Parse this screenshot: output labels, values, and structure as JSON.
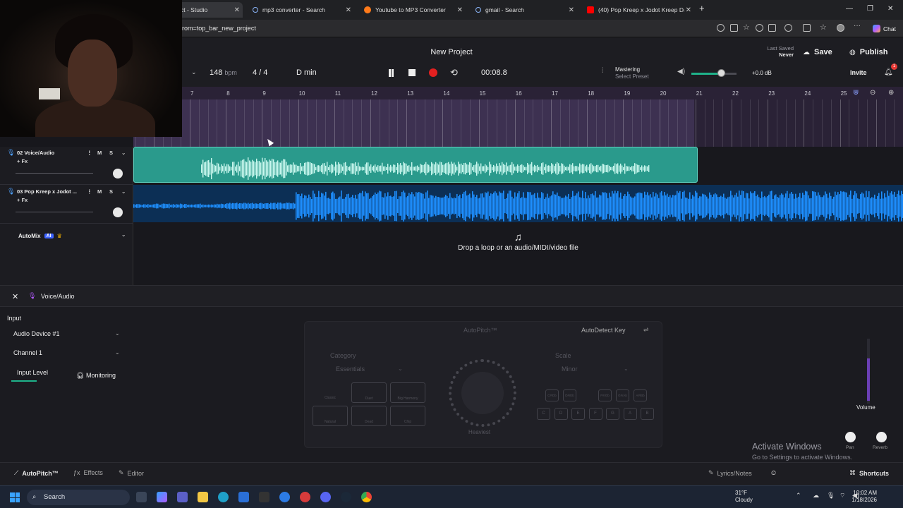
{
  "browser": {
    "tabs": [
      {
        "label": "ct - Studio",
        "active": true
      },
      {
        "label": "mp3 converter - Search"
      },
      {
        "label": "Youtube to MP3 Converter"
      },
      {
        "label": "gmail - Search"
      },
      {
        "label": "(40) Pop Kreep x Jodot Kreep Dark"
      }
    ],
    "url": "rom=top_bar_new_project",
    "chat_label": "Chat"
  },
  "header": {
    "title": "New Project",
    "bpm_value": "148",
    "bpm_unit": "bpm",
    "time_signature": "4 / 4",
    "key": "D min",
    "time": "00:08.8",
    "mastering_label": "Mastering",
    "mastering_sub": "Select Preset",
    "volume_db": "+0.0 dB",
    "last_saved_label": "Last Saved",
    "last_saved_value": "Never",
    "save_label": "Save",
    "publish_label": "Publish",
    "invite_label": "Invite",
    "notification_count": "1",
    "volume_level": 0.66
  },
  "ruler": {
    "bars": [
      "7",
      "8",
      "9",
      "10",
      "11",
      "12",
      "13",
      "14",
      "15",
      "16",
      "17",
      "18",
      "19",
      "20",
      "21",
      "22",
      "23",
      "24",
      "25"
    ]
  },
  "tracks": [
    {
      "name": "02 Voice/Audio",
      "fx": "+ Fx",
      "mute": "M",
      "solo": "S"
    },
    {
      "name": "03 Pop Kreep x Jodot ...",
      "fx": "+ Fx",
      "mute": "M",
      "solo": "S"
    }
  ],
  "automix": {
    "label": "AutoMix",
    "badge": "AI"
  },
  "dropzone": {
    "text": "Drop a loop or an audio/MIDI/video file"
  },
  "panel": {
    "title": "Voice/Audio",
    "input_label": "Input",
    "audio_device": "Audio Device #1",
    "channel": "Channel 1",
    "input_level_label": "Input Level",
    "monitoring_label": "Monitoring",
    "plugin": {
      "name": "AutoPitch™",
      "autodetect_label": "AutoDetect Key",
      "category_label": "Category",
      "category_value": "Essentials",
      "scale_label": "Scale",
      "scale_value": "Minor",
      "knob_label": "Heaviest",
      "preset_buttons": [
        "Classic",
        "Duet",
        "Big Harmony",
        "Natural",
        "Dead",
        "Chip"
      ],
      "key_buttons_top": [
        "C#\nDb",
        "D#\nEb",
        "F#\nGb",
        "G#\nAb",
        "A#\nBb"
      ],
      "key_buttons_bottom": [
        "C",
        "D",
        "E",
        "F",
        "G",
        "A",
        "B"
      ]
    },
    "volume_label": "Volume",
    "pan_label": "Pan",
    "reverb_label": "Reverb",
    "footer": {
      "autopitch_label": "AutoPitch™",
      "effects_label": "Effects",
      "editor_label": "Editor",
      "lyrics_label": "Lyrics/Notes",
      "shortcuts_label": "Shortcuts"
    }
  },
  "watermark": {
    "line1": "Activate Windows",
    "line2": "Go to Settings to activate Windows."
  },
  "taskbar": {
    "search_label": "Search",
    "weather_temp": "31°F",
    "weather_desc": "Cloudy",
    "time": "10:02 AM",
    "date": "1/18/2026"
  },
  "colors": {
    "voice_clip": "#2a9a8c",
    "beat_clip": "#1e8fff",
    "record": "#e32020",
    "accent_green": "#1fb28a"
  }
}
